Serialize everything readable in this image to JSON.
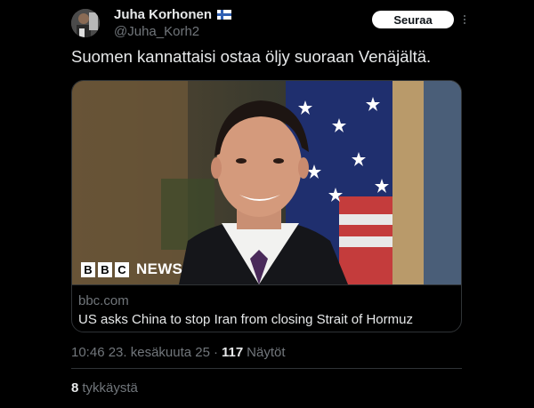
{
  "author": {
    "display_name": "Juha Korhonen",
    "handle": "@Juha_Korh2",
    "verified_flag": "finland-flag-icon"
  },
  "follow_button": {
    "label": "Seuraa"
  },
  "more_menu": {
    "icon": "more-vertical-icon"
  },
  "tweet": {
    "text": "Suomen kannattaisi ostaa öljy suoraan Venäjältä."
  },
  "link_card": {
    "image_logo": {
      "b1": "B",
      "b2": "B",
      "c": "C",
      "news": "NEWS"
    },
    "domain": "bbc.com",
    "title": "US asks China to stop Iran from closing Strait of Hormuz"
  },
  "meta": {
    "time": "10:46 23. kesäkuuta 25",
    "separator": "·",
    "views_count": "117",
    "views_label": "Näytöt"
  },
  "engagement": {
    "likes_count": "8",
    "likes_label": "tykkäystä"
  },
  "colors": {
    "background": "#000000",
    "primary_text": "#e7e9ea",
    "secondary_text": "#71767b",
    "border": "#2f3336",
    "follow_button_bg": "#ffffff"
  }
}
